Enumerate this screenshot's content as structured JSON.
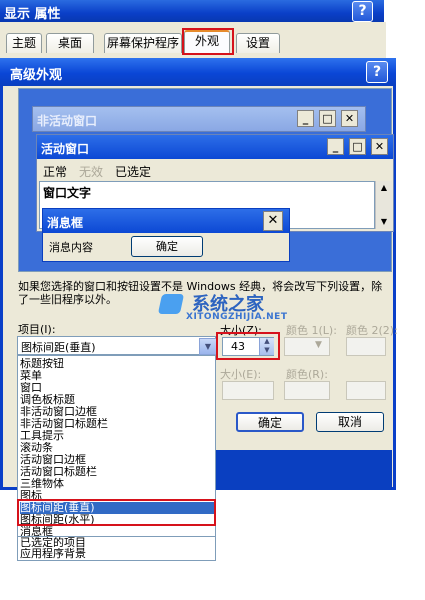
{
  "outer": {
    "title": "显示 属性",
    "help_label": "?",
    "tabs": [
      {
        "label": "主题"
      },
      {
        "label": "桌面"
      },
      {
        "label": "屏幕保护程序"
      },
      {
        "label": "外观"
      },
      {
        "label": "设置"
      }
    ],
    "active_tab": 3
  },
  "dialog": {
    "title": "高级外观",
    "help_label": "?",
    "preview": {
      "inactive_title": "非活动窗口",
      "active_title": "活动窗口",
      "menu": {
        "normal": "正常",
        "disabled": "无效",
        "selected": "已选定"
      },
      "window_text": "窗口文字",
      "msgbox_title": "消息框",
      "msgbox_content": "消息内容",
      "msgbox_ok": "确定",
      "caption_buttons": {
        "minimize": "_",
        "maximize": "□",
        "close": "✕"
      }
    },
    "notice": "如果您选择的窗口和按钮设置不是 Windows 经典，将会改写下列设置，除了一些旧程序以外。",
    "item_label": "项目(I):",
    "item_selected": "图标间距(垂直)",
    "items": [
      "标题按钮",
      "菜单",
      "窗口",
      "调色板标题",
      "非活动窗口边框",
      "非活动窗口标题栏",
      "工具提示",
      "滚动条",
      "活动窗口边框",
      "活动窗口标题栏",
      "三维物体",
      "图标",
      "图标间距(垂直)",
      "图标间距(水平)",
      "消息框",
      "已选定的项目",
      "应用程序背景"
    ],
    "selected_index": 12,
    "size1_label": "大小(Z):",
    "size1_value": "43",
    "color1_label": "颜色 1(L):",
    "color2_label": "颜色 2(2):",
    "size2_label": "大小(E):",
    "color3_label": "颜色(R):",
    "ok_label": "确定",
    "cancel_label": "取消"
  },
  "watermark": {
    "name": "系统之家",
    "url": "XITONGZHIJIA.NET"
  }
}
